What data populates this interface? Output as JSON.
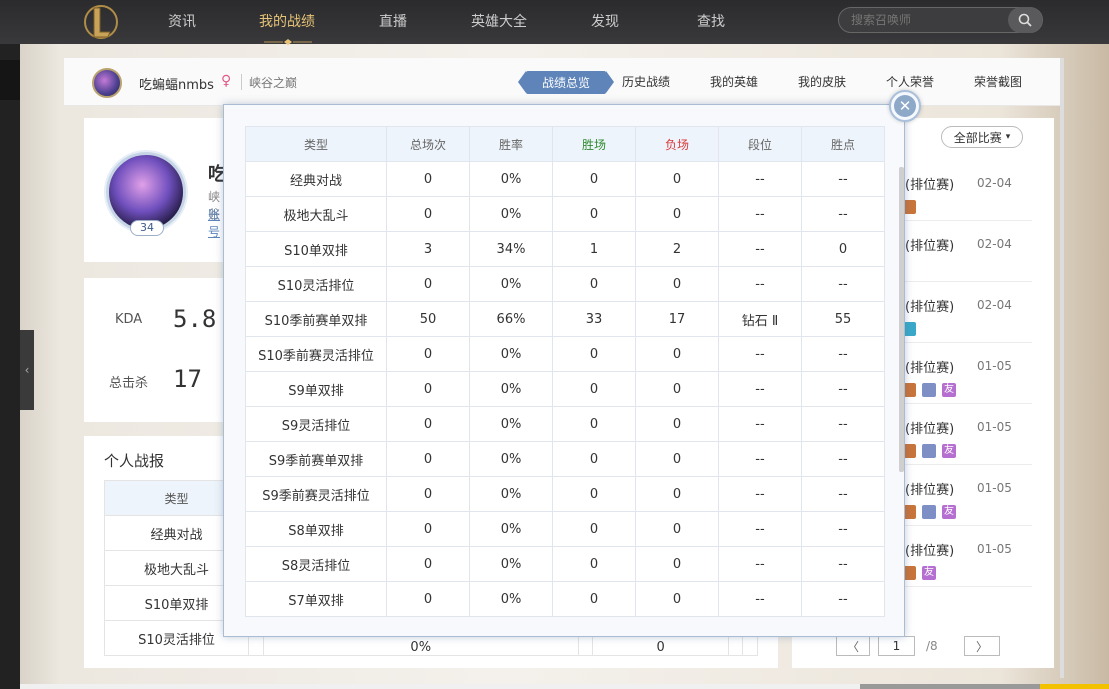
{
  "nav": {
    "items": [
      "资讯",
      "我的战绩",
      "直播",
      "英雄大全",
      "发现",
      "查找"
    ],
    "active_index": 1,
    "search_placeholder": "搜索召唤师"
  },
  "user": {
    "name": "吃蝙蝠nmbs",
    "gender_symbol": "♀",
    "server": "峡谷之巅",
    "level": "34",
    "name_partial": "吃",
    "server_partial": "峡谷",
    "account_partial": "账号"
  },
  "tabs": [
    "战绩总览",
    "历史战绩",
    "我的英雄",
    "我的皮肤",
    "个人荣誉",
    "荣誉截图"
  ],
  "stats": {
    "kda_label": "KDA",
    "kda_value": "5.8",
    "kills_label": "总击杀",
    "kills_value": "17"
  },
  "report": {
    "title": "个人战报",
    "header_type": "类型",
    "rows": [
      "经典对战",
      "极地大乱斗",
      "S10单双排",
      "S10灵活排位"
    ],
    "partial_values": [
      "0%",
      "0"
    ]
  },
  "right_panel": {
    "filter_label": "全部比赛",
    "matches": [
      {
        "title": "(排位赛)",
        "date": "02-04"
      },
      {
        "title": "(排位赛)",
        "date": "02-04"
      },
      {
        "title": "(排位赛)",
        "date": "02-04"
      },
      {
        "title": "(排位赛)",
        "date": "01-05"
      },
      {
        "title": "(排位赛)",
        "date": "01-05"
      },
      {
        "title": "(排位赛)",
        "date": "01-05"
      },
      {
        "title": "(排位赛)",
        "date": "01-05"
      }
    ],
    "friend_tag": "友",
    "pager": {
      "prev": "〈",
      "current": "1",
      "total": "/8",
      "next": "〉"
    }
  },
  "overview": {
    "headers": [
      "类型",
      "总场次",
      "胜率",
      "胜场",
      "负场",
      "段位",
      "胜点"
    ],
    "header_colors": {
      "win": "#2f8a2f",
      "loss": "#d93a3a"
    },
    "rows": [
      [
        "经典对战",
        "0",
        "0%",
        "0",
        "0",
        "--",
        "--"
      ],
      [
        "极地大乱斗",
        "0",
        "0%",
        "0",
        "0",
        "--",
        "--"
      ],
      [
        "S10单双排",
        "3",
        "34%",
        "1",
        "2",
        "--",
        "0"
      ],
      [
        "S10灵活排位",
        "0",
        "0%",
        "0",
        "0",
        "--",
        "--"
      ],
      [
        "S10季前赛单双排",
        "50",
        "66%",
        "33",
        "17",
        "钻石 Ⅱ",
        "55"
      ],
      [
        "S10季前赛灵活排位",
        "0",
        "0%",
        "0",
        "0",
        "--",
        "--"
      ],
      [
        "S9单双排",
        "0",
        "0%",
        "0",
        "0",
        "--",
        "--"
      ],
      [
        "S9灵活排位",
        "0",
        "0%",
        "0",
        "0",
        "--",
        "--"
      ],
      [
        "S9季前赛单双排",
        "0",
        "0%",
        "0",
        "0",
        "--",
        "--"
      ],
      [
        "S9季前赛灵活排位",
        "0",
        "0%",
        "0",
        "0",
        "--",
        "--"
      ],
      [
        "S8单双排",
        "0",
        "0%",
        "0",
        "0",
        "--",
        "--"
      ],
      [
        "S8灵活排位",
        "0",
        "0%",
        "0",
        "0",
        "--",
        "--"
      ],
      [
        "S7单双排",
        "0",
        "0%",
        "0",
        "0",
        "--",
        "--"
      ]
    ],
    "close_symbol": "✕"
  },
  "colors": {
    "accent": "#5e84b9",
    "gold": "#e6c376"
  }
}
